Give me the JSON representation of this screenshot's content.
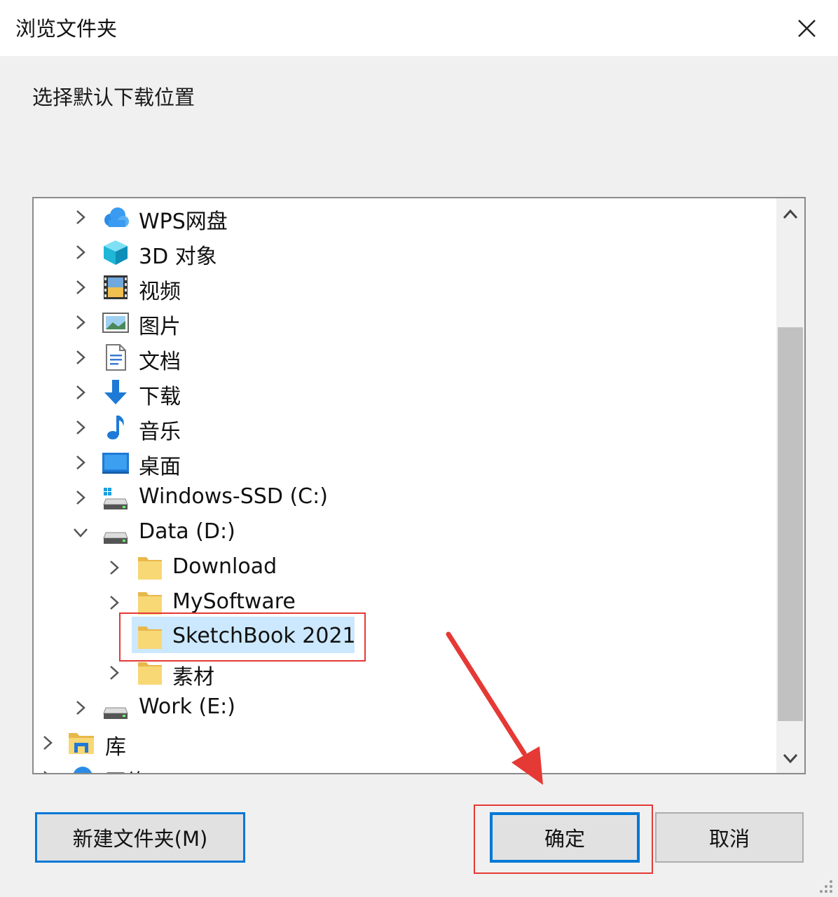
{
  "window": {
    "title": "浏览文件夹"
  },
  "prompt": "选择默认下载位置",
  "tree": {
    "items": [
      {
        "label": "WPS网盘",
        "icon": "cloud-icon",
        "expander": "collapsed"
      },
      {
        "label": "3D 对象",
        "icon": "3d-objects-icon",
        "expander": "collapsed"
      },
      {
        "label": "视频",
        "icon": "videos-icon",
        "expander": "collapsed"
      },
      {
        "label": "图片",
        "icon": "pictures-icon",
        "expander": "collapsed"
      },
      {
        "label": "文档",
        "icon": "documents-icon",
        "expander": "collapsed"
      },
      {
        "label": "下载",
        "icon": "downloads-icon",
        "expander": "collapsed"
      },
      {
        "label": "音乐",
        "icon": "music-icon",
        "expander": "collapsed"
      },
      {
        "label": "桌面",
        "icon": "desktop-icon",
        "expander": "collapsed"
      },
      {
        "label": "Windows-SSD (C:)",
        "icon": "system-drive-icon",
        "expander": "collapsed"
      },
      {
        "label": "Data (D:)",
        "icon": "drive-icon",
        "expander": "expanded"
      },
      {
        "label": "Download",
        "icon": "folder-icon",
        "expander": "collapsed"
      },
      {
        "label": "MySoftware",
        "icon": "folder-icon",
        "expander": "collapsed"
      },
      {
        "label": "SketchBook 2021",
        "icon": "folder-icon",
        "expander": "none",
        "selected": true
      },
      {
        "label": "素材",
        "icon": "folder-icon",
        "expander": "collapsed"
      },
      {
        "label": "Work (E:)",
        "icon": "drive-icon",
        "expander": "collapsed"
      },
      {
        "label": "库",
        "icon": "libraries-icon",
        "expander": "collapsed"
      },
      {
        "label": "网络",
        "icon": "network-icon",
        "expander": "collapsed"
      }
    ]
  },
  "buttons": {
    "new_folder": "新建文件夹(M)",
    "ok": "确定",
    "cancel": "取消"
  },
  "colors": {
    "accent": "#0078d7",
    "selection": "#cce8ff",
    "annotation": "#e53935",
    "folder": "#f8d775"
  }
}
